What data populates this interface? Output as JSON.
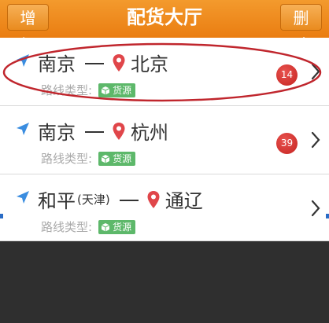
{
  "header": {
    "title": "配货大厅",
    "add_label": "增加",
    "delete_label": "删除"
  },
  "colors": {
    "header": "#ea7d11",
    "badge": "#c62320",
    "tag": "#5db86a",
    "nav_arrow": "#3a8de0",
    "pin": "#e0464a",
    "annotation": "#c0262d"
  },
  "routes": [
    {
      "from": "南京",
      "from_note": "",
      "to": "北京",
      "type_label": "路线类型:",
      "tag_label": "货源",
      "badge": "14",
      "icons": [
        "navigation-arrow-icon",
        "location-pin-icon",
        "box-icon",
        "chevron-right-icon"
      ]
    },
    {
      "from": "南京",
      "from_note": "",
      "to": "杭州",
      "type_label": "路线类型:",
      "tag_label": "货源",
      "badge": "39",
      "icons": [
        "navigation-arrow-icon",
        "location-pin-icon",
        "box-icon",
        "chevron-right-icon"
      ]
    },
    {
      "from": "和平",
      "from_note": "(天津)",
      "to": "通辽",
      "type_label": "路线类型:",
      "tag_label": "货源",
      "badge": "",
      "icons": [
        "navigation-arrow-icon",
        "location-pin-icon",
        "box-icon",
        "chevron-right-icon"
      ]
    }
  ]
}
